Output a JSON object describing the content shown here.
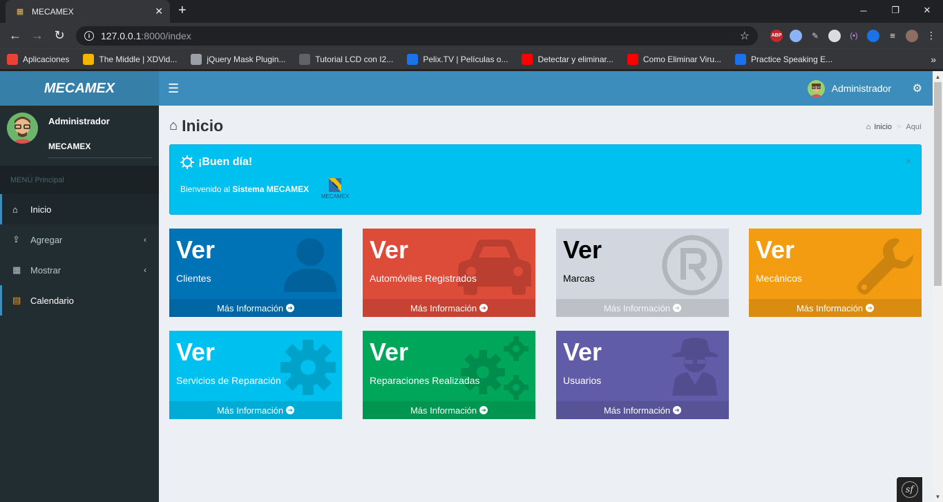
{
  "browser": {
    "tab_title": "MECAMEX",
    "url_host": "127.0.0.1",
    "url_path": ":8000/index",
    "bookmarks": [
      {
        "label": "Aplicaciones",
        "color": "#ea4335"
      },
      {
        "label": "The Middle | XDVid...",
        "color": "#f4b400"
      },
      {
        "label": "jQuery Mask Plugin...",
        "color": "#9aa0a6"
      },
      {
        "label": "Tutorial LCD con I2...",
        "color": "#5f6368"
      },
      {
        "label": "Pelix.TV | Películas o...",
        "color": "#1a73e8"
      },
      {
        "label": "Detectar y eliminar...",
        "color": "#ff0000"
      },
      {
        "label": "Como Eliminar Viru...",
        "color": "#ff0000"
      },
      {
        "label": "Practice Speaking E...",
        "color": "#1a73e8"
      }
    ],
    "ext_abp": "ABP"
  },
  "app": {
    "logo": "MECAMEX",
    "header_user": "Administrador",
    "sidebar": {
      "user_name": "Administrador",
      "user_org": "MECAMEX",
      "menu_header": "MENÚ Principal",
      "items": [
        {
          "label": "Inicio"
        },
        {
          "label": "Agregar"
        },
        {
          "label": "Mostrar"
        },
        {
          "label": "Calendario"
        }
      ]
    },
    "page_title": "Inicio",
    "breadcrumb": {
      "home": "Inicio",
      "current": "Aquí"
    },
    "alert": {
      "title": "¡Buen día!",
      "text_prefix": "Bienvenido al ",
      "text_bold": "Sistema MECAMEX",
      "logo_text": "MECAMEX",
      "close": "×"
    },
    "boxes": [
      {
        "ver": "Ver",
        "label": "Clientes",
        "more": "Más Información",
        "color": "#0073b7",
        "icon": "user-icon"
      },
      {
        "ver": "Ver",
        "label": "Automóviles Registrados",
        "more": "Más Información",
        "color": "#dd4b39",
        "icon": "car-icon"
      },
      {
        "ver": "Ver",
        "label": "Marcas",
        "more": "Más Información",
        "color": "#d2d6de",
        "icon": "registered-icon"
      },
      {
        "ver": "Ver",
        "label": "Mecánicos",
        "more": "Más Información",
        "color": "#f39c12",
        "icon": "wrench-icon"
      },
      {
        "ver": "Ver",
        "label": "Servicios de Reparación",
        "more": "Más Información",
        "color": "#00c0ef",
        "icon": "gear-icon"
      },
      {
        "ver": "Ver",
        "label": "Reparaciones Realizadas",
        "more": "Más Información",
        "color": "#00a65a",
        "icon": "gears-icon"
      },
      {
        "ver": "Ver",
        "label": "Usuarios",
        "more": "Más Información",
        "color": "#605ca8",
        "icon": "user-secret-icon"
      }
    ]
  }
}
